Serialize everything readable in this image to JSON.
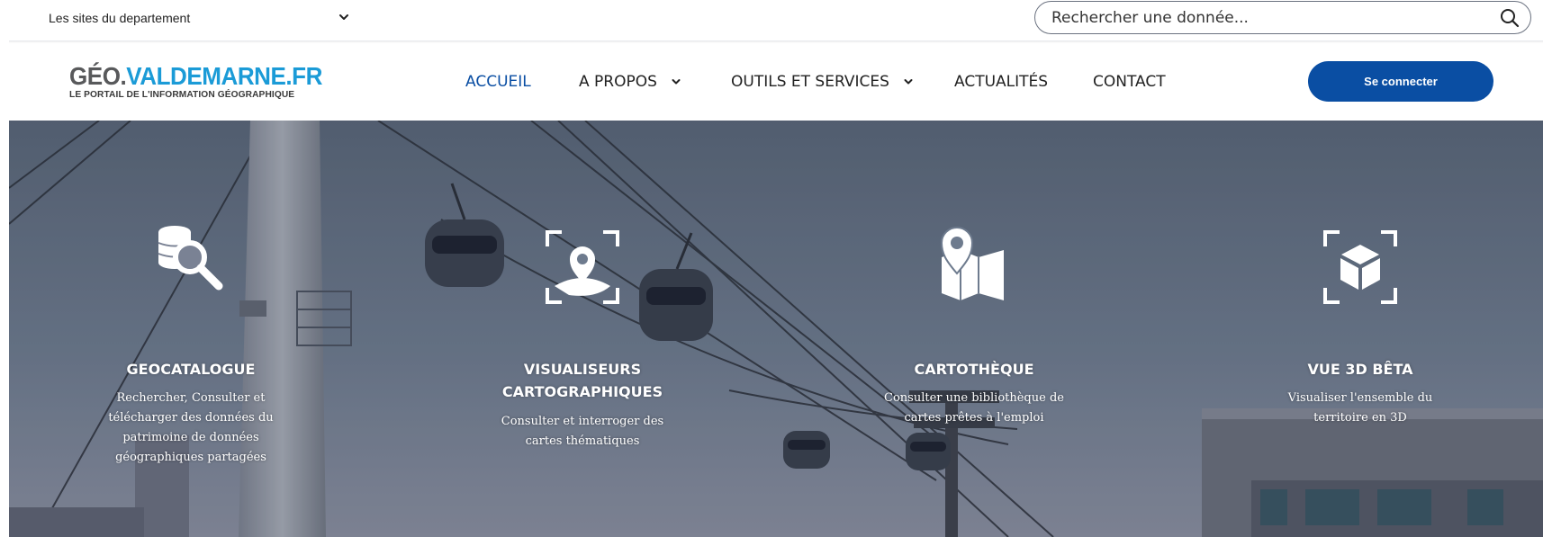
{
  "topbar": {
    "sites_label": "Les sites du departement",
    "search_placeholder": "Rechercher une donnée..."
  },
  "header": {
    "logo_part1": "GÉO.",
    "logo_part2": "VALDEMARNE.FR",
    "logo_subtitle": "LE PORTAIL DE L'INFORMATION GÉOGRAPHIQUE",
    "nav": {
      "accueil": "ACCUEIL",
      "a_propos": "A PROPOS",
      "outils": "OUTILS ET SERVICES",
      "actualites": "ACTUALITÉS",
      "contact": "CONTACT"
    },
    "login_label": "Se connecter"
  },
  "features": [
    {
      "icon": "database-search-icon",
      "title": "GEOCATALOGUE",
      "desc_lines": [
        "Rechercher, Consulter et",
        "télécharger des données du",
        "patrimoine de données",
        "géographiques partagées"
      ]
    },
    {
      "icon": "map-viewer-icon",
      "title_lines": [
        "VISUALISEURS",
        "CARTOGRAPHIQUES"
      ],
      "desc_lines": [
        "Consulter et interroger des",
        "cartes thématiques"
      ]
    },
    {
      "icon": "folded-map-pin-icon",
      "title": "CARTOTHÈQUE",
      "desc_lines": [
        "Consulter une bibliothèque de",
        "cartes prêtes à l'emploi"
      ]
    },
    {
      "icon": "3d-cube-icon",
      "title": "VUE 3D BÊTA",
      "desc_lines": [
        "Visualiser l'ensemble du",
        "territoire en 3D"
      ]
    }
  ],
  "colors": {
    "brand_blue": "#0a4ea3",
    "logo_blue": "#1b9bd7",
    "logo_grey": "#58595b"
  }
}
